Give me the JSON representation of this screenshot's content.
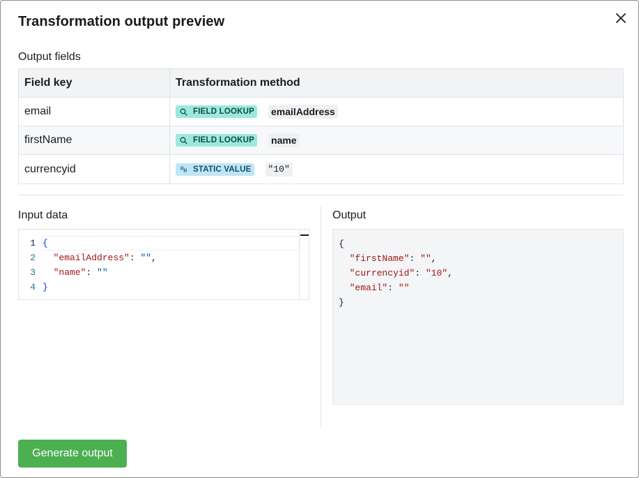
{
  "modal": {
    "title": "Transformation output preview",
    "close_icon": "close-icon"
  },
  "output_fields": {
    "label": "Output fields",
    "columns": [
      "Field key",
      "Transformation method"
    ],
    "rows": [
      {
        "key": "email",
        "method": "FIELD LOOKUP",
        "method_icon": "search-icon",
        "value": "emailAddress"
      },
      {
        "key": "firstName",
        "method": "FIELD LOOKUP",
        "method_icon": "search-icon",
        "value": "name"
      },
      {
        "key": "currencyid",
        "method": "STATIC VALUE",
        "method_icon": "quote-icon",
        "value": "\"10\""
      }
    ]
  },
  "input_data": {
    "label": "Input data",
    "line_numbers": [
      "1",
      "2",
      "3",
      "4"
    ],
    "lines": {
      "l1": "{",
      "l2_key": "\"emailAddress\"",
      "l2_colon": ": ",
      "l2_val": "\"\"",
      "l2_comma": ",",
      "l3_key": "\"name\"",
      "l3_colon": ": ",
      "l3_val": "\"\"",
      "l4": "}"
    }
  },
  "output": {
    "label": "Output",
    "open": "{",
    "entries": [
      {
        "key": "\"firstName\"",
        "value": "\"\"",
        "sep": ","
      },
      {
        "key": "\"currencyid\"",
        "value": "\"10\"",
        "sep": ","
      },
      {
        "key": "\"email\"",
        "value": "\"\"",
        "sep": ""
      }
    ],
    "close": "}"
  },
  "actions": {
    "generate_label": "Generate output"
  },
  "colors": {
    "accent_green": "#4caf50",
    "lookup_badge": "#9ce8dc",
    "static_badge": "#bfe6f5"
  }
}
